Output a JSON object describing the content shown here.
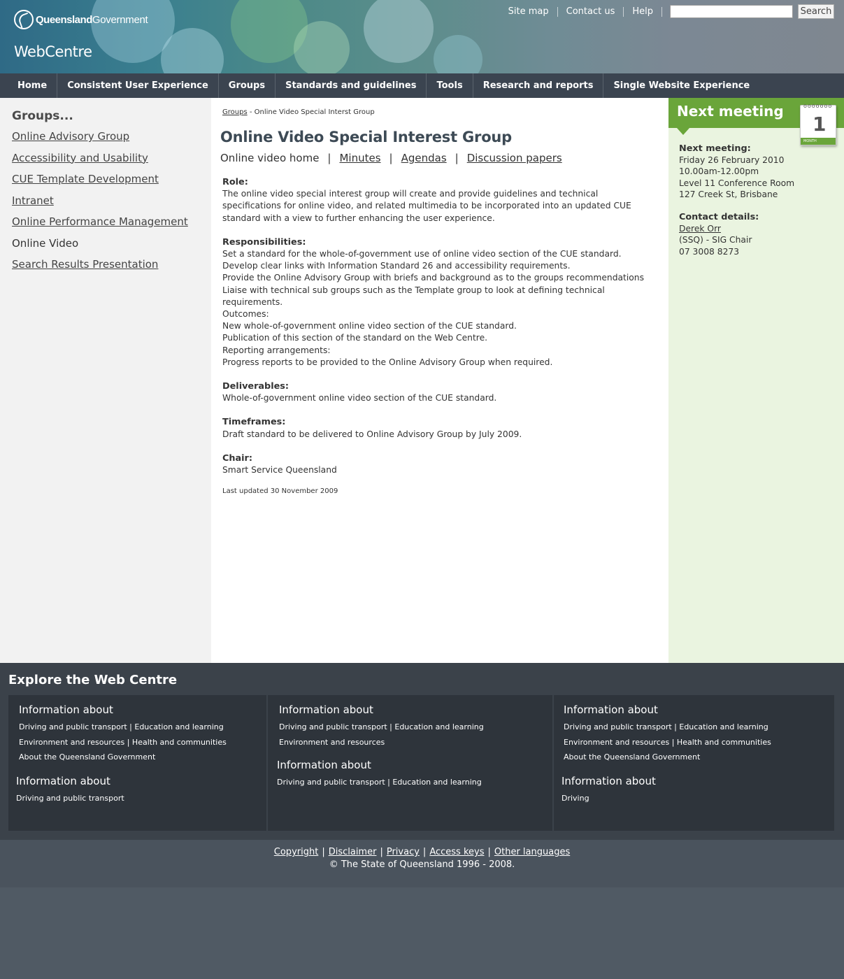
{
  "header": {
    "logo_primary": "Queensland",
    "logo_secondary": "Government",
    "site_title": "WebCentre",
    "util_links": [
      "Site map",
      "Contact us",
      "Help"
    ],
    "search_placeholder": "",
    "search_button": "Search"
  },
  "nav": [
    "Home",
    "Consistent User Experience",
    "Groups",
    "Standards and guidelines",
    "Tools",
    "Research and reports",
    "Single Website Experience"
  ],
  "sidebar": {
    "title": "Groups...",
    "items": [
      {
        "label": "Online Advisory Group",
        "current": false
      },
      {
        "label": "Accessibility and Usability",
        "current": false
      },
      {
        "label": "CUE Template Development",
        "current": false
      },
      {
        "label": "Intranet",
        "current": false
      },
      {
        "label": "Online Performance Management",
        "current": false
      },
      {
        "label": "Online Video",
        "current": true
      },
      {
        "label": "Search Results Presentation",
        "current": false
      }
    ]
  },
  "main": {
    "breadcrumb_link": "Groups",
    "breadcrumb_sep": " - ",
    "breadcrumb_current": "Online Video Special Interst Group",
    "title": "Online Video Special Interest Group",
    "subnav_current": "Online video home",
    "subnav_links": [
      "Minutes",
      "Agendas",
      "Discussion papers"
    ],
    "subnav_sep": "|",
    "role_heading": "Role:",
    "role_text": "The online video special interest group will create and provide guidelines and technical specifications for online video, and related multimedia to be incorporated into an updated CUE standard with a view to further enhancing the user experience.",
    "resp_heading": "Responsibilities:",
    "resp_lines": [
      "Set a standard for the whole-of-government use of online video section of the CUE standard.",
      "Develop clear links with Information Standard 26 and accessibility requirements.",
      "Provide the Online Advisory Group with briefs and background as to the groups recommendations",
      "Liaise with technical sub groups such as the Template group to look at defining technical requirements.",
      "Outcomes:",
      "New whole-of-government online video section of the CUE standard.",
      "Publication of this section of the standard on the Web Centre.",
      "Reporting arrangements:",
      "Progress reports to be provided to the Online Advisory Group when required."
    ],
    "deliv_heading": "Deliverables:",
    "deliv_text": "Whole-of-government online video section of the CUE standard.",
    "time_heading": "Timeframes:",
    "time_text": "Draft standard to be delivered to Online Advisory Group by July 2009.",
    "chair_heading": "Chair:",
    "chair_text": "Smart Service Queensland",
    "updated": "Last updated 30 November 2009"
  },
  "right": {
    "banner": "Next meeting",
    "calendar_num": "1",
    "calendar_label": "MONTH",
    "meeting_heading": "Next meeting:",
    "meeting_lines": [
      "Friday 26 February 2010",
      "10.00am-12.00pm",
      "Level 11 Conference Room",
      "127 Creek St, Brisbane"
    ],
    "contact_heading": "Contact details:",
    "contact_name": "Derek Orr",
    "contact_role": "(SSQ) - SIG Chair",
    "contact_phone": "07 3008 8273"
  },
  "explore": {
    "title": "Explore the Web Centre",
    "panels": [
      {
        "groups": [
          {
            "heading": "Information about",
            "lines": [
              "Driving and public transport | Education and learning",
              "Environment and resources | Health and communities",
              "About the Queensland Government"
            ]
          },
          {
            "heading": "Information about",
            "lines": [
              "Driving and public transport"
            ]
          }
        ]
      },
      {
        "groups": [
          {
            "heading": "Information about",
            "lines": [
              "Driving and public transport | Education and learning",
              "Environment and resources"
            ]
          },
          {
            "heading": "Information about",
            "lines": [
              "Driving and public transport | Education and learning"
            ]
          }
        ]
      },
      {
        "groups": [
          {
            "heading": "Information about",
            "lines": [
              "Driving and public transport | Education and learning",
              "Environment and resources | Health and communities",
              "About the Queensland Government"
            ]
          },
          {
            "heading": "Information about",
            "lines": [
              "Driving"
            ]
          }
        ]
      }
    ]
  },
  "legal": {
    "links": [
      "Copyright",
      "Disclaimer",
      "Privacy",
      "Access keys",
      "Other languages"
    ],
    "sep": "|",
    "copyright": "© The State of Queensland 1996 - 2008."
  },
  "colors": {
    "nav_bg": "#3b4450",
    "accent_green": "#6aa53a",
    "right_bg": "#eaf4e0",
    "footer_bg": "#3b424a"
  }
}
